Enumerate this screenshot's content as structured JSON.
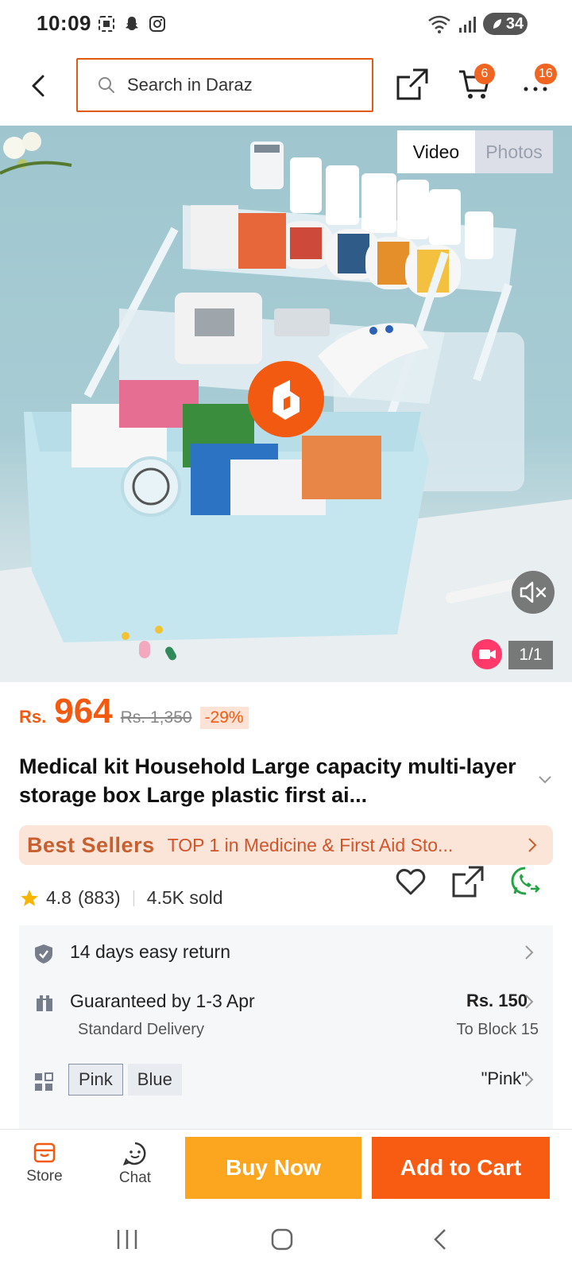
{
  "status_bar": {
    "time": "10:09",
    "battery": "34",
    "left_icons": [
      "screenshot-icon",
      "snapchat-icon",
      "instagram-icon"
    ],
    "right_icons": [
      "wifi-icon",
      "signal-icon"
    ]
  },
  "top_nav": {
    "search_placeholder": "Search in Daraz",
    "cart_badge": "6",
    "more_badge": "16"
  },
  "media": {
    "tabs": [
      {
        "label": "Video",
        "active": true
      },
      {
        "label": "Photos",
        "active": false
      }
    ],
    "counter": "1/1"
  },
  "product": {
    "price_currency": "Rs.",
    "price": "964",
    "original_price": "Rs. 1,350",
    "discount": "-29%",
    "title": "Medical kit Household Large capacity multi-layer storage box Large plastic first ai...",
    "best_seller_label": "Best Sellers",
    "best_seller_text": "TOP 1 in Medicine & First Aid Sto...",
    "rating": "4.8",
    "reviews": "(883)",
    "sold": "4.5K sold"
  },
  "info": {
    "return": "14 days easy return",
    "delivery_title": "Guaranteed by 1-3 Apr",
    "delivery_sub": "Standard Delivery",
    "delivery_price": "Rs. 150",
    "delivery_to": "To Block 15",
    "variants": [
      "Pink",
      "Blue"
    ],
    "selected_variant": "\"Pink\""
  },
  "bottom_bar": {
    "store": "Store",
    "chat": "Chat",
    "buy_now": "Buy Now",
    "add_to_cart": "Add to Cart"
  },
  "colors": {
    "brand_orange": "#f25a12",
    "buy_now": "#fba61e",
    "add_to_cart": "#f85b12",
    "badge": "#f16522",
    "whatsapp": "#25a244"
  }
}
